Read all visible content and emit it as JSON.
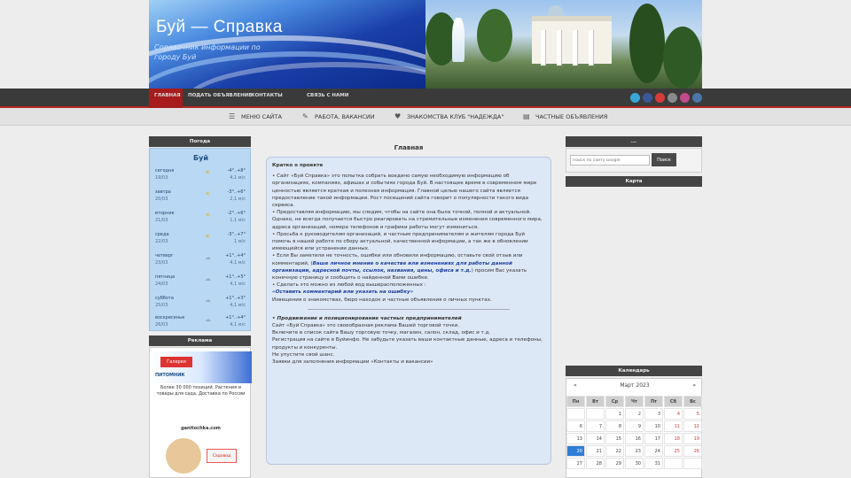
{
  "site": {
    "title": "Буй — Справка",
    "subtitle": "Справочник информации по городу Буй"
  },
  "nav": {
    "items": [
      "ГЛАВНАЯ",
      "ПОДАТЬ ОБЪЯВЛЕНИЕ",
      "КОНТАКТЫ",
      "СВЯЗЬ С НАМИ"
    ],
    "social": [
      {
        "name": "twitter",
        "color": "#3aa5d8"
      },
      {
        "name": "facebook",
        "color": "#3b5998"
      },
      {
        "name": "youtube",
        "color": "#d83a3a"
      },
      {
        "name": "odnoklassniki",
        "color": "#8a8a8a"
      },
      {
        "name": "instagram",
        "color": "#c04a8a"
      },
      {
        "name": "vk",
        "color": "#4a76a8"
      }
    ]
  },
  "submenu": {
    "items": [
      {
        "icon": "menu-icon",
        "label": "МЕНЮ САЙТА"
      },
      {
        "icon": "wrench-icon",
        "label": "РАБОТА, ВАКАНСИИ"
      },
      {
        "icon": "heart-icon",
        "label": "ЗНАКОМСТВА КЛУБ \"НАДЕЖДА\""
      },
      {
        "icon": "document-icon",
        "label": "ЧАСТНЫЕ ОБЪЯВЛЕНИЯ"
      }
    ]
  },
  "weather": {
    "header": "Погода",
    "city": "Буй",
    "days": [
      {
        "day": "сегодня",
        "date": "19/03",
        "temp": "-4°..+8°",
        "wind": "4,1 м/с"
      },
      {
        "day": "завтра",
        "date": "20/03",
        "temp": "-3°..+6°",
        "wind": "2,1 м/с"
      },
      {
        "day": "вторник",
        "date": "21/03",
        "temp": "-2°..+6°",
        "wind": "1,1 м/с"
      },
      {
        "day": "среда",
        "date": "22/03",
        "temp": "-3°..+7°",
        "wind": "1 м/с"
      },
      {
        "day": "четверг",
        "date": "23/03",
        "temp": "+1°..+4°",
        "wind": "4,1 м/с"
      },
      {
        "day": "пятница",
        "date": "24/03",
        "temp": "+1°..+5°",
        "wind": "4,1 м/с"
      },
      {
        "day": "суббота",
        "date": "25/03",
        "temp": "+1°..+3°",
        "wind": "4,1 м/с"
      },
      {
        "day": "воскресенье",
        "date": "26/03",
        "temp": "+1°..+4°",
        "wind": "4,1 м/с"
      }
    ]
  },
  "ad": {
    "header": "Реклама",
    "badge": "Галерея",
    "brand": "ПИТОМНИК",
    "text": "Более 30 000 позиций. Растения и товары для сада. Доставка по России",
    "site_url": "ganitochka.com",
    "logo": "Садовод"
  },
  "main": {
    "title": "Главная",
    "heading": "Кратко о проекте",
    "paragraphs": [
      "• Сайт «Буй Справка» это попытка собрать воедино самую необходимую информацию об организациях, компаниях, афишах и событиях города Буй. В настоящее время в современном мире ценностью является краткая и полезная информация. Главной целью нашего сайта является предоставление такой информации. Рост посещений сайта говорит о популярности такого вида сервиса.",
      "• Предоставляя информацию, мы следим, чтобы на сайте она была точной, полной и актуальной. Однако, не всегда получается быстро реагировать на стремительные изменения современного мира, адреса организаций, номера телефонов и графики работы могут измениться.",
      "• Просьба к руководителям организаций, и частным предпринимателям и жителям города Буй помочь в нашей работе по сбору актуальной, качественной информации, а так же в обновлении имеющейся или устранении данных.",
      "• Если Вы заметили не точность, ошибки или обновили информацию, оставьте свой отзыв или комментарий, (",
      ") просим Вас указать конечную страницу и сообщить о найденной Вами ошибке.",
      "• Сделать это можно из любой вод вышерасположенных :",
      "Извещения о знакомствах, бюро находок и частные объявления о личных пунктах."
    ],
    "link1": "Ваше личное мнение о качестве или изменениях для работы данной организации, адресной почты, ссылок, названия, цены, офиса и т.д.",
    "link2": "«Оставить комментарий или указать на ошибку»",
    "section2_heading": "• Продвижение и позиционирование частных предпринимателей",
    "section2": [
      "Сайт «Буй Справка» это своеобразная реклама Вашей торговой точки.",
      "Включите в список сайта Вашу торговую точку, магазин, салон, склад, офис и т.д.",
      "Регистрация на сайте в Буйинфо. Не забудьте указать ваши контактные данные, адреса и телефоны, продукты и конкуренты.",
      "Не упустите свой шанс.",
      "Заявки для заполнения информации «Контакты и вакансии»"
    ],
    "link3": "«Буй Справка»",
    "link4": "Буйинфо",
    "link5": "«Контакты и вакансии»"
  },
  "search": {
    "header": "...",
    "placeholder": "Поиск по сайту Google",
    "button": "Поиск"
  },
  "map": {
    "header": "Карта"
  },
  "calendar": {
    "header": "Календарь",
    "month": "Март 2023",
    "prev": "«",
    "next": "»",
    "weekdays": [
      "Пн",
      "Вт",
      "Ср",
      "Чт",
      "Пт",
      "Сб",
      "Вс"
    ],
    "weeks": [
      [
        "",
        "",
        "1",
        "2",
        "3",
        "4",
        "5"
      ],
      [
        "6",
        "7",
        "8",
        "9",
        "10",
        "11",
        "12"
      ],
      [
        "13",
        "14",
        "15",
        "16",
        "17",
        "18",
        "19"
      ],
      [
        "20",
        "21",
        "22",
        "23",
        "24",
        "25",
        "26"
      ],
      [
        "27",
        "28",
        "29",
        "30",
        "31",
        "",
        ""
      ]
    ],
    "today": "20",
    "weekend_color": "#d23b3b"
  }
}
